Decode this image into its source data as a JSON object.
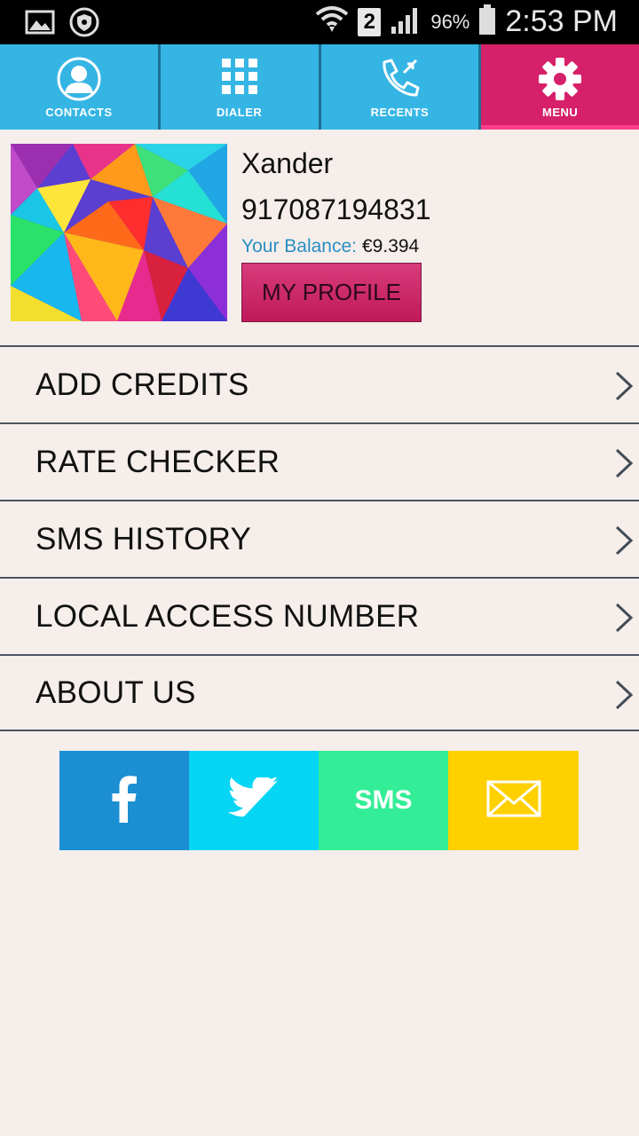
{
  "status_bar": {
    "battery_percent": "96%",
    "time": "2:53 PM",
    "sim": "2",
    "icons": [
      "image-icon",
      "shield-icon",
      "wifi-icon",
      "signal-icon",
      "battery-icon"
    ]
  },
  "tabs": [
    {
      "label": "CONTACTS",
      "icon": "person-icon",
      "active": false
    },
    {
      "label": "DIALER",
      "icon": "dialpad-icon",
      "active": false
    },
    {
      "label": "RECENTS",
      "icon": "phone-calls-icon",
      "active": false
    },
    {
      "label": "MENU",
      "icon": "gear-icon",
      "active": true
    }
  ],
  "profile": {
    "name": "Xander",
    "phone": "917087194831",
    "balance_label": "Your Balance:",
    "balance_value": "€9.394",
    "button_label": "MY PROFILE"
  },
  "menu": {
    "items": [
      {
        "label": "ADD CREDITS"
      },
      {
        "label": "RATE CHECKER"
      },
      {
        "label": "SMS HISTORY"
      },
      {
        "label": "LOCAL ACCESS NUMBER"
      },
      {
        "label": "ABOUT US"
      }
    ]
  },
  "share": {
    "sms_label": "SMS",
    "colors": {
      "facebook": "#1c8fd3",
      "twitter": "#06d6f4",
      "sms": "#33ee96",
      "email": "#ffd000"
    }
  },
  "colors": {
    "tab_blue": "#35b5e4",
    "tab_active": "#d6216a",
    "background": "#f6eeeb",
    "balance_label": "#2a8fc3"
  }
}
